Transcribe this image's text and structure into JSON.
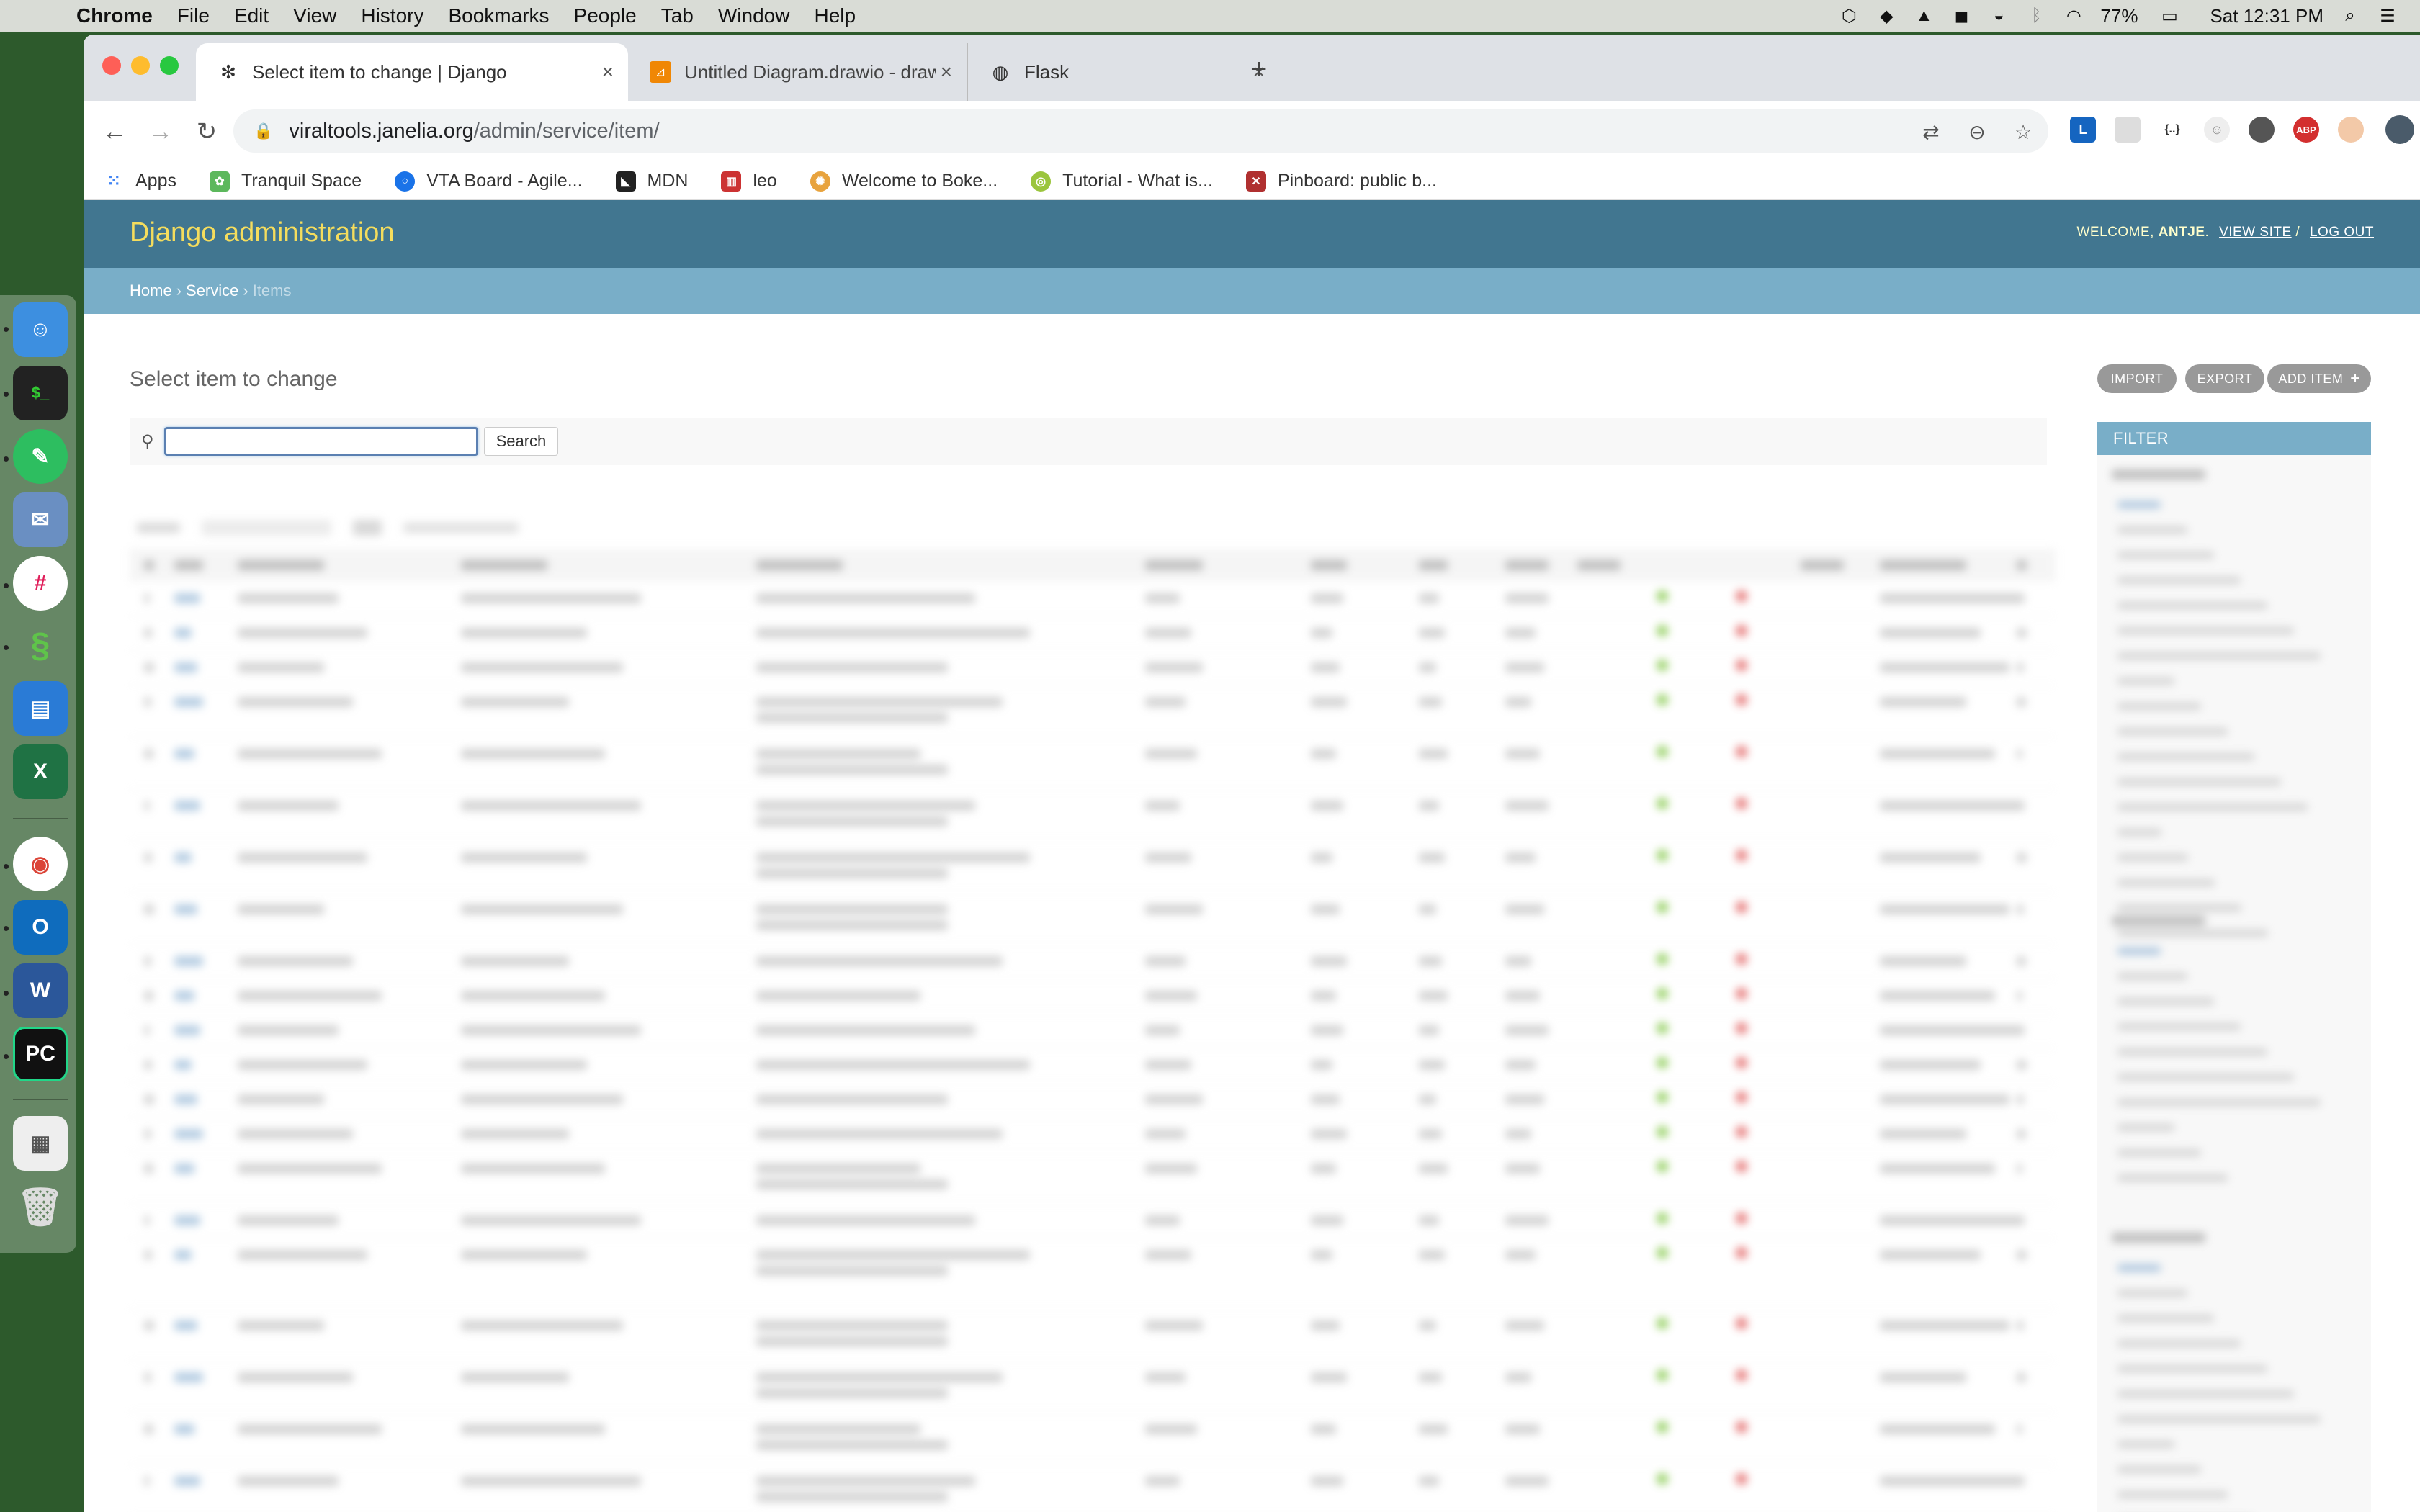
{
  "menubar": {
    "app": "Chrome",
    "items": [
      "File",
      "Edit",
      "View",
      "History",
      "Bookmarks",
      "People",
      "Tab",
      "Window",
      "Help"
    ],
    "battery": "77%",
    "clock": "Sat 12:31 PM"
  },
  "tabs": [
    {
      "title": "Select item to change | Django",
      "favicon": "django-gear-icon"
    },
    {
      "title": "Untitled Diagram.drawio - draw",
      "favicon": "drawio-icon"
    },
    {
      "title": "Flask",
      "favicon": "globe-icon"
    }
  ],
  "omnibox": {
    "host": "viraltools.janelia.org",
    "path": "/admin/service/item/"
  },
  "bookmarks": [
    {
      "label": "Apps",
      "color": "#4285f4"
    },
    {
      "label": "Tranquil Space",
      "color": "#5cb85c"
    },
    {
      "label": "VTA Board - Agile...",
      "color": "#1a73e8"
    },
    {
      "label": "MDN",
      "color": "#222222"
    },
    {
      "label": "leo",
      "color": "#cc3333"
    },
    {
      "label": "Welcome to Boke...",
      "color": "#e8a33d"
    },
    {
      "label": "Tutorial - What is...",
      "color": "#9bc53d"
    },
    {
      "label": "Pinboard: public b...",
      "color": "#b03030"
    }
  ],
  "django": {
    "branding": "Django administration",
    "welcome": "WELCOME,",
    "user": "ANTJE",
    "view_site": "VIEW SITE",
    "slash": "/",
    "log_out": "LOG OUT",
    "breadcrumbs": {
      "home": "Home",
      "service": "Service",
      "current": "Items",
      "sep": "›"
    },
    "title": "Select item to change",
    "tools": {
      "import": "IMPORT",
      "export": "EXPORT",
      "add": "ADD ITEM"
    },
    "search": {
      "value": "",
      "button": "Search"
    },
    "filter_title": "FILTER"
  },
  "colors": {
    "header": "#417690",
    "branding": "#f5dd5d",
    "breadcrumbs": "#79aec8",
    "ok": "#70bf2b",
    "bad": "#dd4646"
  }
}
